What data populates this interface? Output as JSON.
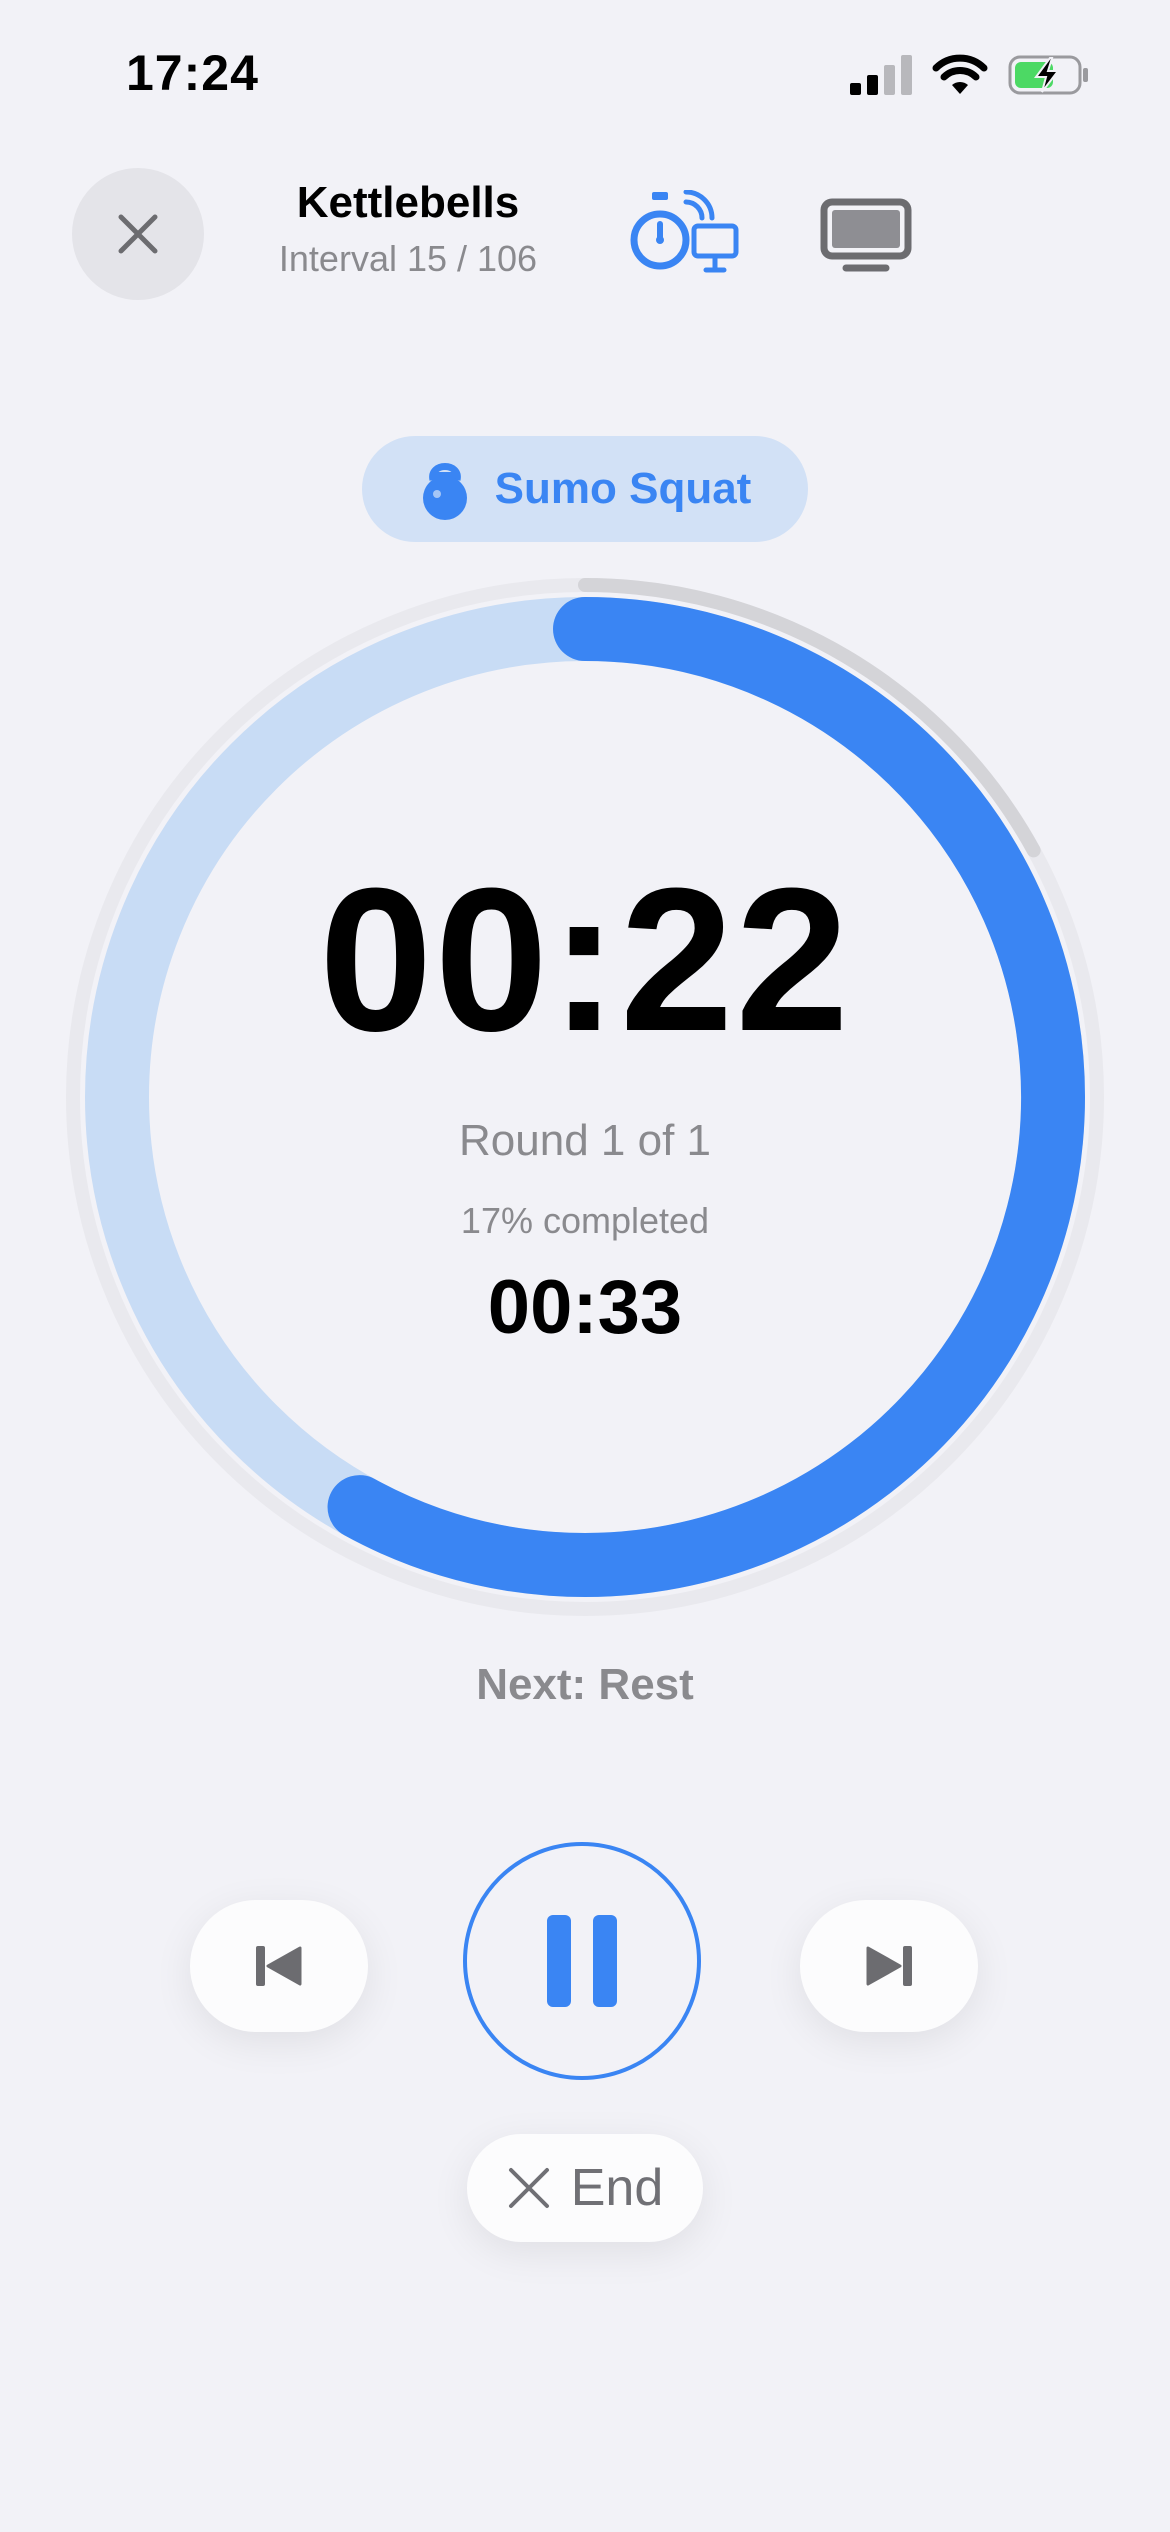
{
  "status_bar": {
    "time": "17:24"
  },
  "header": {
    "title": "Kettlebells",
    "subtitle": "Interval 15 / 106"
  },
  "exercise": {
    "name": "Sumo Squat"
  },
  "timer": {
    "remaining": "00:22",
    "round_text": "Round 1 of 1",
    "completed_text": "17% completed",
    "total_elapsed": "00:33",
    "interval_progress": 0.58,
    "workout_progress": 0.17
  },
  "next_label": "Next: Rest",
  "controls": {
    "end_label": "End"
  },
  "colors": {
    "accent": "#3a85f3",
    "accent_light": "#c8dcf5",
    "background": "#f2f2f7"
  },
  "icons": {
    "close": "close-icon",
    "stopwatch_cast": "stopwatch-cast-icon",
    "tv": "tv-icon",
    "kettlebell": "kettlebell-icon",
    "previous": "skip-previous-icon",
    "pause": "pause-icon",
    "next": "skip-next-icon",
    "end": "close-icon"
  }
}
